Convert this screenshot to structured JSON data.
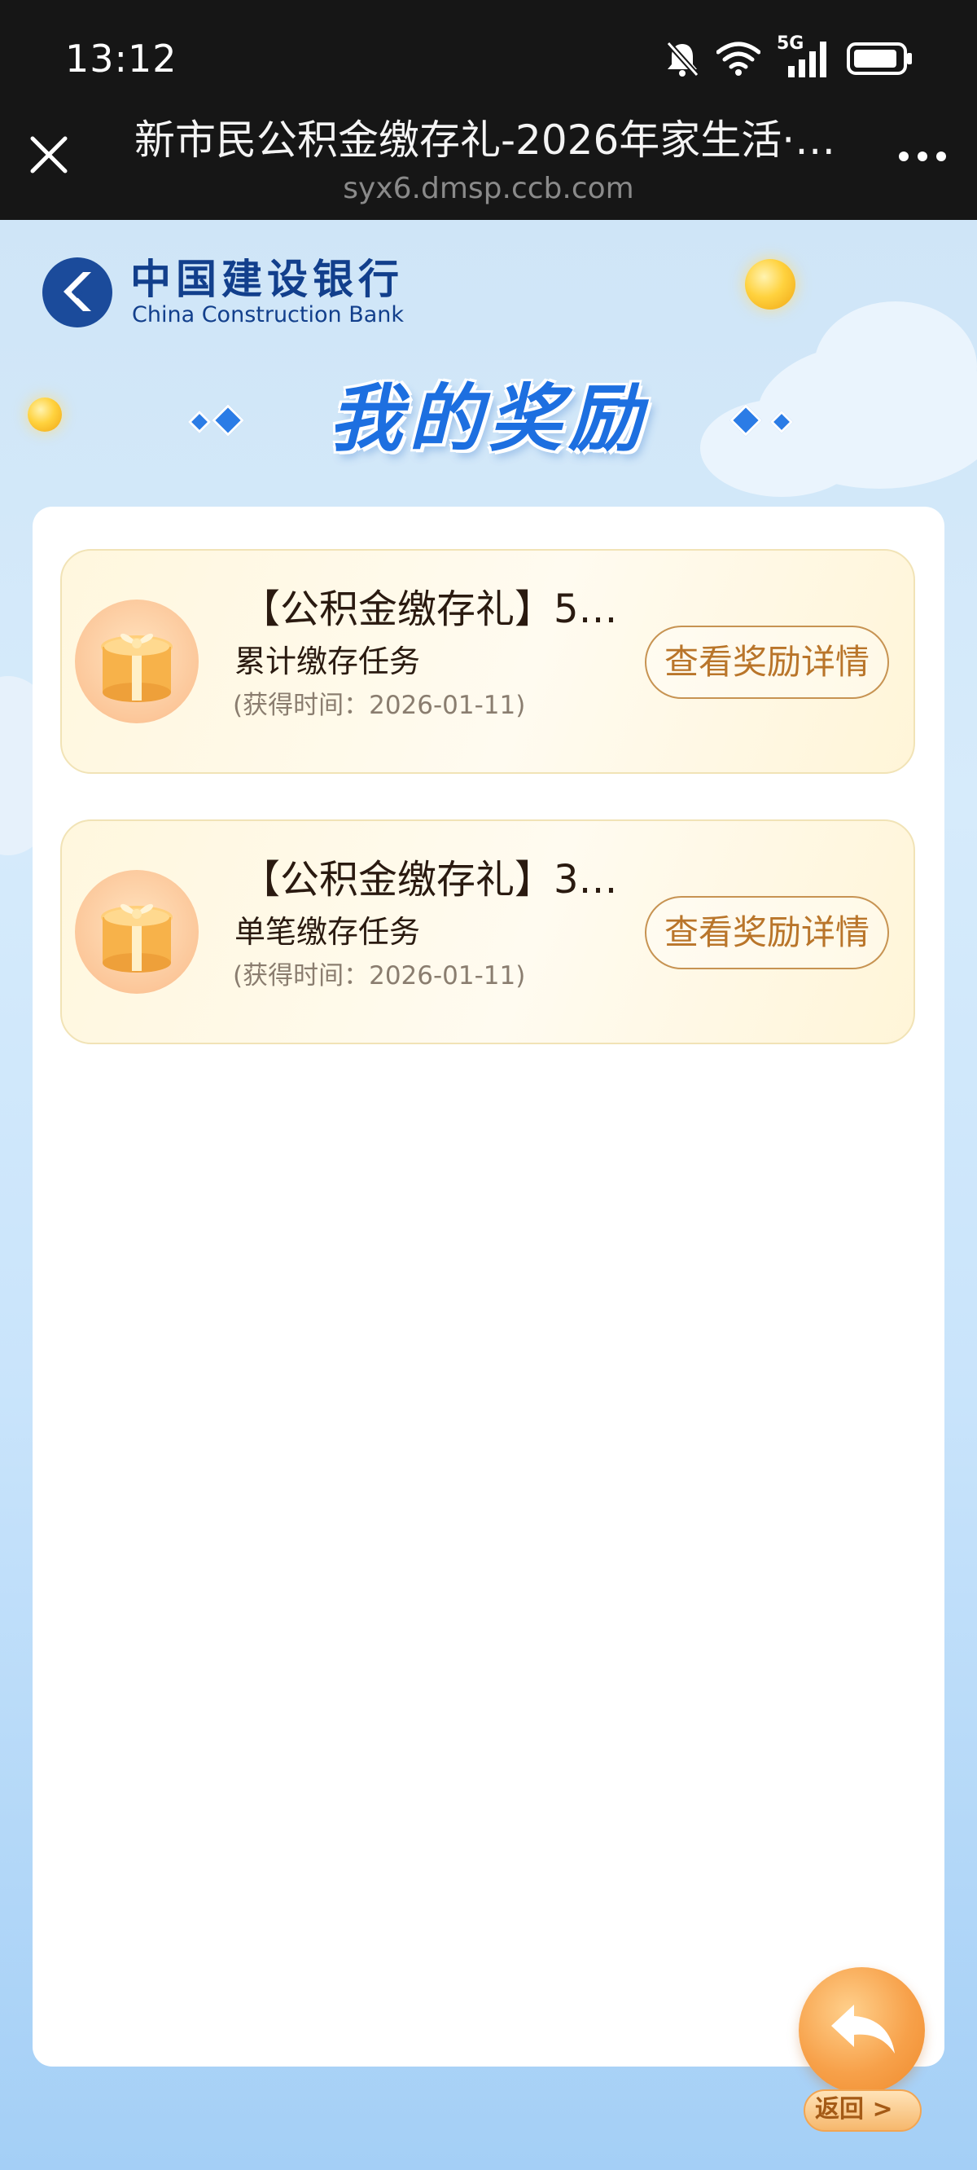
{
  "status_bar": {
    "time": "13:12",
    "icons": [
      "bell-muted-icon",
      "wifi-icon",
      "5g-signal-icon",
      "battery-icon"
    ],
    "network_label": "5G"
  },
  "browser": {
    "title": "新市民公积金缴存礼-2026年家生活·…",
    "url": "syx6.dmsp.ccb.com",
    "close_icon": "close-icon",
    "more_icon": "more-icon"
  },
  "brand": {
    "name_cn": "中国建设银行",
    "name_en": "China Construction Bank",
    "color": "#123f8c"
  },
  "page": {
    "title": "我的奖励",
    "title_color": "#1d6fe0"
  },
  "rewards": [
    {
      "title": "【公积金缴存礼】5…",
      "task": "累计缴存任务",
      "time": "(获得时间：2026-01-11)",
      "button": "查看奖励详情"
    },
    {
      "title": "【公积金缴存礼】3…",
      "task": "单笔缴存任务",
      "time": "(获得时间：2026-01-11)",
      "button": "查看奖励详情"
    }
  ],
  "back_button": {
    "label": "返回 >",
    "icon": "back-arrow-icon"
  },
  "colors": {
    "accent_orange": "#b9752a",
    "card_bg": "#fff8e3",
    "page_bg": "#cfe5f7"
  }
}
